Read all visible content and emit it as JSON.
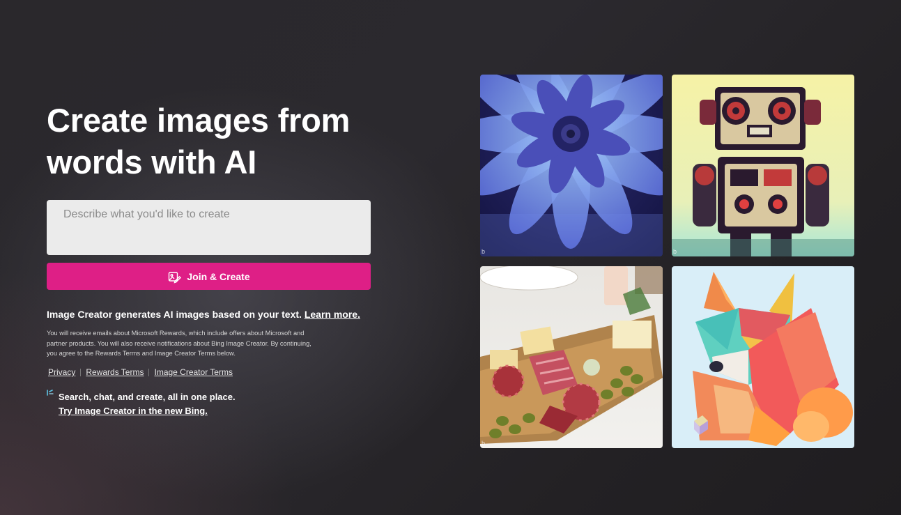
{
  "hero": {
    "headline_line1": "Create images from",
    "headline_line2": "words with AI"
  },
  "prompt": {
    "placeholder": "Describe what you'd like to create"
  },
  "join_button": {
    "label": "Join & Create",
    "icon": "image-create-icon",
    "color": "#de1f86"
  },
  "info": {
    "text": "Image Creator generates AI images based on your text.",
    "learn_more": "Learn more."
  },
  "disclaimer": "You will receive emails about Microsoft Rewards, which include offers about Microsoft and partner products. You will also receive notifications about Bing Image Creator. By continuing, you agree to the Rewards Terms and Image Creator Terms below.",
  "links": {
    "privacy": "Privacy",
    "rewards_terms": "Rewards Terms",
    "image_creator_terms": "Image Creator Terms"
  },
  "promo": {
    "icon": "bing-sparkle-icon",
    "text": "Search, chat, and create, all in one place.",
    "link": "Try Image Creator in the new Bing."
  },
  "gallery": {
    "watermark": "b",
    "tiles": [
      {
        "subject": "blue-dahlia-flower-image"
      },
      {
        "subject": "retro-robot-image"
      },
      {
        "subject": "charcuterie-board-image"
      },
      {
        "subject": "paper-fox-image"
      }
    ]
  }
}
